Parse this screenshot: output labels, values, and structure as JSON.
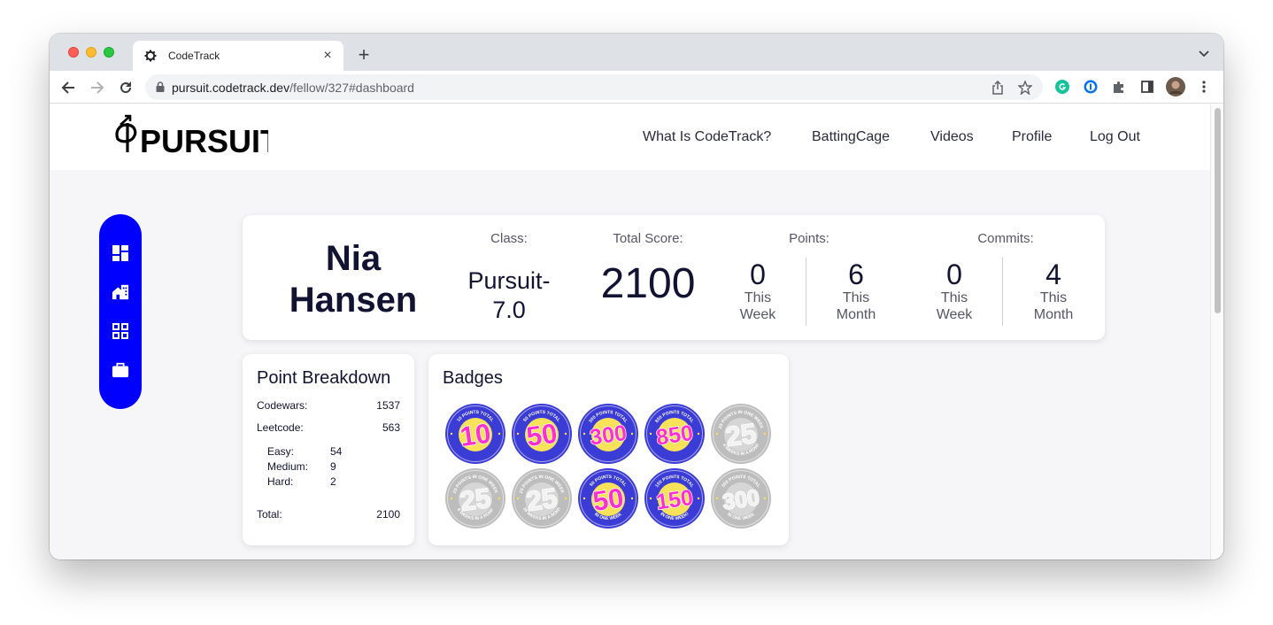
{
  "browser": {
    "tab_title": "CodeTrack",
    "new_tab": "+",
    "tab_close": "×",
    "url_host": "pursuit.codetrack.dev",
    "url_path": "/fellow/327#dashboard"
  },
  "site": {
    "logo_text": "PURSUIT",
    "nav": [
      "What Is CodeTrack?",
      "BattingCage",
      "Videos",
      "Profile",
      "Log Out"
    ]
  },
  "sidebar": {
    "icons": [
      "dashboard-icon",
      "home-work-icon",
      "grid-icon",
      "briefcase-icon"
    ]
  },
  "profile": {
    "first_name": "Nia",
    "last_name": "Hansen",
    "class_label": "Class:",
    "class_line1": "Pursuit-",
    "class_line2": "7.0",
    "score_label": "Total Score:",
    "score": "2100",
    "points_label": "Points:",
    "commits_label": "Commits:",
    "points_week": "0",
    "points_month": "6",
    "commits_week": "0",
    "commits_month": "4",
    "this_label": "This",
    "week_label": "Week",
    "month_label": "Month"
  },
  "breakdown": {
    "title": "Point Breakdown",
    "codewars_label": "Codewars:",
    "codewars": "1537",
    "leetcode_label": "Leetcode:",
    "leetcode": "563",
    "easy_label": "Easy:",
    "easy": "54",
    "medium_label": "Medium:",
    "medium": "9",
    "hard_label": "Hard:",
    "hard": "2",
    "total_label": "Total:",
    "total": "2100"
  },
  "badges": {
    "title": "Badges",
    "items": [
      {
        "value": "10",
        "top": "10 POINTS TOTAL",
        "bottom": "",
        "earned": true
      },
      {
        "value": "50",
        "top": "50 POINTS TOTAL",
        "bottom": "",
        "earned": true
      },
      {
        "value": "300",
        "top": "300 POINTS TOTAL",
        "bottom": "",
        "earned": true
      },
      {
        "value": "850",
        "top": "850 POINTS TOTAL",
        "bottom": "",
        "earned": true
      },
      {
        "value": "25",
        "top": "25 POINTS IN ONE WEEK",
        "bottom": "4 WEEKS IN A ROW!",
        "earned": false
      },
      {
        "value": "25",
        "top": "25 POINTS IN ONE WEEK",
        "bottom": "8 WEEKS IN A ROW!",
        "earned": false
      },
      {
        "value": "25",
        "top": "25 POINTS IN ONE WEEK",
        "bottom": "16 WEEKS IN A ROW!",
        "earned": false
      },
      {
        "value": "50",
        "top": "50 POINTS TOTAL",
        "bottom": "IN ONE WEEK",
        "earned": true
      },
      {
        "value": "150",
        "top": "150 POINTS TOTAL",
        "bottom": "IN ONE WEEK!",
        "earned": true
      },
      {
        "value": "300",
        "top": "300 POINTS TOTAL",
        "bottom": "IN ONE WEEK",
        "earned": false
      }
    ]
  },
  "colors": {
    "sidebar": "#0000ff",
    "badge_ring": "#3b3bd6",
    "badge_inner": "#f7e25a",
    "badge_text": "#ff2fd0",
    "badge_gray": "#bdbdbd"
  }
}
